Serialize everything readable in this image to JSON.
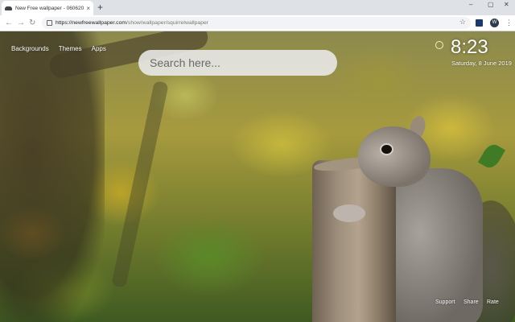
{
  "browser": {
    "tab_title": "New Free wallpaper - 06062019…",
    "tab_close": "×",
    "new_tab": "+",
    "window_controls": {
      "minimize": "–",
      "maximize": "▢",
      "close": "✕"
    },
    "nav": {
      "back": "←",
      "forward": "→",
      "reload": "↻"
    },
    "url_host": "https://newfreewallpaper.com",
    "url_path": "/show/wallpaper/squirrelwallpaper",
    "bookmark": "☆",
    "extension_badge": "W",
    "menu": "⋮"
  },
  "page": {
    "nav": {
      "backgrounds": "Backgrounds",
      "themes": "Themes",
      "apps": "Apps"
    },
    "search": {
      "placeholder": "Search here..."
    },
    "clock": {
      "time": "8:23",
      "date": "Saturday, 8 June 2019"
    },
    "footer": {
      "support": "Support",
      "share": "Share",
      "rate": "Rate"
    }
  },
  "icons": {
    "favicon": "new-free-wallpaper-favicon",
    "lock": "lock-icon",
    "weather": "sun-icon"
  }
}
